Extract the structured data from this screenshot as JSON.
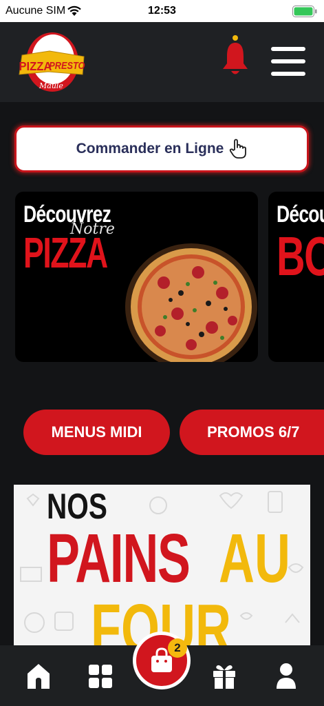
{
  "status_bar": {
    "carrier": "Aucune SIM",
    "time": "12:53"
  },
  "header": {
    "logo": {
      "brand_top": "PIZZA",
      "brand_right": "PRESTO",
      "city": "Maule"
    },
    "bell_icon": "bell-icon",
    "menu_icon": "hamburger-icon"
  },
  "order_button": {
    "label": "Commander en Ligne",
    "icon": "hand-pointer-icon"
  },
  "carousel": [
    {
      "title": "Découvrez",
      "script": "Notre",
      "highlight": "PIZZA"
    },
    {
      "title": "Décou",
      "highlight": "BO"
    }
  ],
  "category_pills": [
    {
      "label": "MENUS MIDI"
    },
    {
      "label": "PROMOS 6/7"
    }
  ],
  "banner": {
    "line1": "NOS",
    "line2_red": "PAINS",
    "line2_yellow": "AU",
    "line3": "FOUR"
  },
  "bottom_nav": {
    "items": [
      "home-icon",
      "grid-icon",
      "cart-icon",
      "gift-icon",
      "user-icon"
    ],
    "cart_count": "2"
  },
  "colors": {
    "brand_red": "#d1161e",
    "accent_yellow": "#f5b80f",
    "dark_bg": "#1e2022",
    "battery_green": "#34c759"
  }
}
